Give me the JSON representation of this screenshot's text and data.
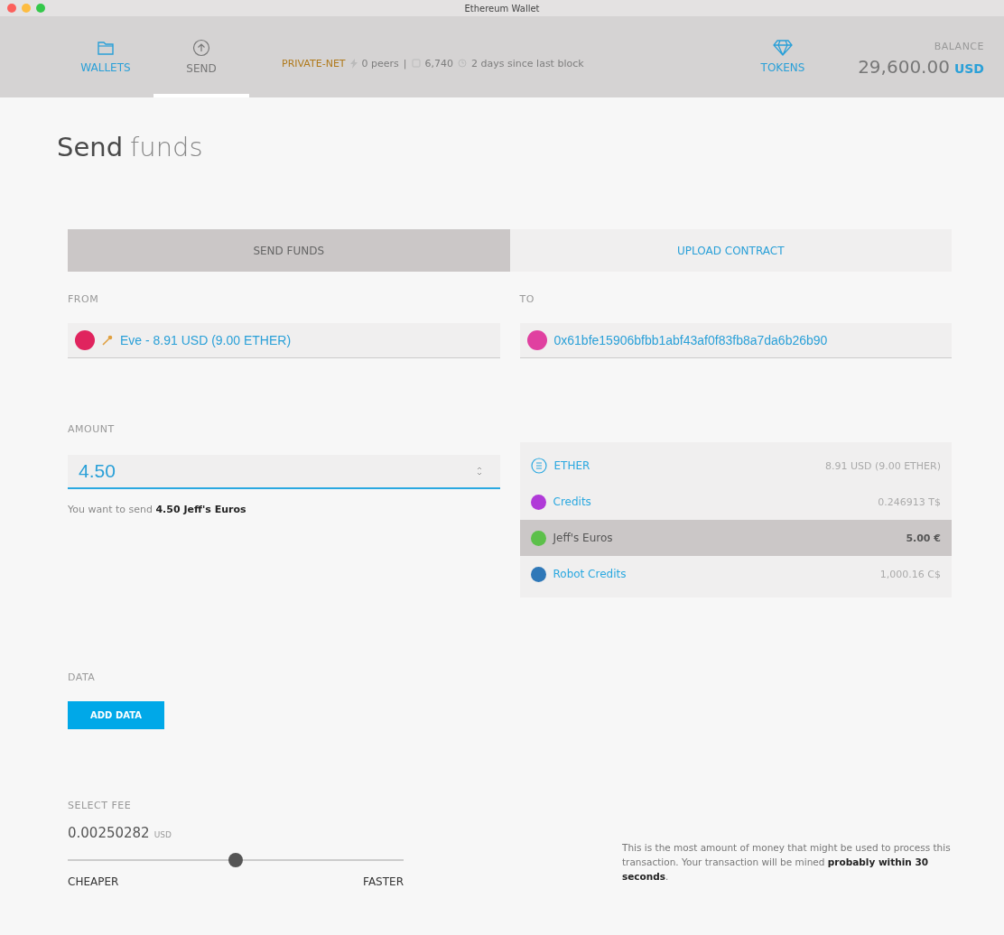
{
  "window": {
    "title": "Ethereum Wallet"
  },
  "nav": [
    {
      "label": "WALLETS",
      "selected": false
    },
    {
      "label": "SEND",
      "selected": true
    }
  ],
  "status": {
    "network": "PRIVATE-NET",
    "peers": "0 peers",
    "separator": "|",
    "block": "6,740",
    "since": "2 days since last block"
  },
  "tokens_nav": {
    "label": "TOKENS",
    "selected": false
  },
  "balance": {
    "label": "BALANCE",
    "amount": "29,600.00",
    "currency": "USD"
  },
  "heading": {
    "bold": "Send",
    "light": "funds"
  },
  "tabs": [
    {
      "label": "SEND FUNDS",
      "selected": true
    },
    {
      "label": "UPLOAD CONTRACT",
      "selected": false
    }
  ],
  "from": {
    "label": "FROM",
    "value": "Eve - 8.91 USD (9.00 ETHER)",
    "color": "#e0245e"
  },
  "to": {
    "label": "TO",
    "value": "0x61bfe15906bfbb1abf43af0f83fb8a7da6b26b90",
    "color": "#e040a0"
  },
  "amount": {
    "label": "AMOUNT",
    "value": "4.50",
    "summary": "You want to send **4.50 Jeff's Euros**"
  },
  "tokens": [
    {
      "kind": "ether",
      "name": "ETHER",
      "balance": "8.91 USD (9.00 ETHER)",
      "selected": false
    },
    {
      "kind": "token",
      "name": "Credits",
      "balance": "0.246913 T$",
      "color": "#b03ad8",
      "selected": false
    },
    {
      "kind": "token",
      "name": "Jeff's Euros",
      "balance": "5.00 €",
      "color": "#5cc04a",
      "selected": true
    },
    {
      "kind": "token",
      "name": "Robot Credits",
      "balance": "1,000.16 C$",
      "color": "#2f78b8",
      "selected": false
    }
  ],
  "data": {
    "label": "DATA",
    "button": "ADD DATA"
  },
  "fee": {
    "label": "SELECT FEE",
    "amount": "0.00250282",
    "currency": "USD",
    "level": 0.5,
    "min_label": "CHEAPER",
    "max_label": "FASTER",
    "note": "This is the most amount of money that might be used to process this transaction. Your transaction will be mined **probably within 30 seconds**."
  }
}
